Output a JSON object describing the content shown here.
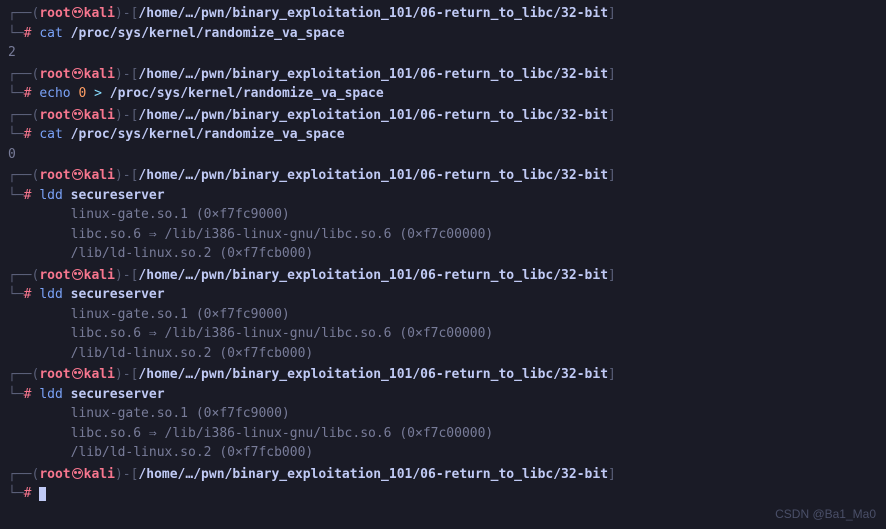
{
  "prompt": {
    "user": "root",
    "host": "kali",
    "path": "/home/…/pwn/binary_exploitation_101/06-return_to_libc/32-bit",
    "symbol": "#",
    "top_prefix": "┌──(",
    "top_suffix": ")-[",
    "top_end": "]",
    "bot_prefix": "└─"
  },
  "blocks": [
    {
      "cmd": "cat",
      "args": "/proc/sys/kernel/randomize_va_space",
      "out": [
        "2"
      ]
    },
    {
      "cmd": "echo",
      "args_parts": {
        "pre": "0",
        "op": ">",
        "post": "/proc/sys/kernel/randomize_va_space"
      },
      "out": []
    },
    {
      "cmd": "cat",
      "args": "/proc/sys/kernel/randomize_va_space",
      "out": [
        "0"
      ]
    },
    {
      "cmd": "ldd",
      "args": "secureserver",
      "out": [
        "        linux-gate.so.1 (0×f7fc9000)",
        "        libc.so.6 ⇒ /lib/i386-linux-gnu/libc.so.6 (0×f7c00000)",
        "        /lib/ld-linux.so.2 (0×f7fcb000)"
      ]
    },
    {
      "cmd": "ldd",
      "args": "secureserver",
      "out": [
        "        linux-gate.so.1 (0×f7fc9000)",
        "        libc.so.6 ⇒ /lib/i386-linux-gnu/libc.so.6 (0×f7c00000)",
        "        /lib/ld-linux.so.2 (0×f7fcb000)"
      ]
    },
    {
      "cmd": "ldd",
      "args": "secureserver",
      "out": [
        "        linux-gate.so.1 (0×f7fc9000)",
        "        libc.so.6 ⇒ /lib/i386-linux-gnu/libc.so.6 (0×f7c00000)",
        "        /lib/ld-linux.so.2 (0×f7fcb000)"
      ]
    },
    {
      "cmd": "",
      "args": "",
      "out": [],
      "cursor": true
    }
  ],
  "watermark": "CSDN @Ba1_Ma0"
}
